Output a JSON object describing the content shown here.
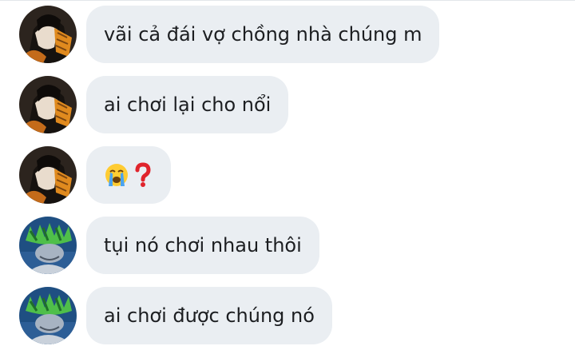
{
  "messages": [
    {
      "sender": "user-a",
      "text": "vãi cả đái vợ chồng nhà chúng m"
    },
    {
      "sender": "user-a",
      "text": "ai chơi lại cho nổi"
    },
    {
      "sender": "user-a",
      "icons": [
        "loudly-crying-face-icon",
        "red-question-mark-icon"
      ]
    },
    {
      "sender": "user-b",
      "text": "tụi nó chơi nhau thôi"
    },
    {
      "sender": "user-b",
      "text": "ai chơi được chúng nó"
    }
  ],
  "colors": {
    "bubble_bg": "#eaeef2",
    "text": "#1c1e21",
    "avatar_a_bg": "#3a2e24",
    "avatar_a_accent": "#e08a1e",
    "avatar_b_bg": "#1f4f82",
    "avatar_b_accent": "#4fbf4a"
  }
}
